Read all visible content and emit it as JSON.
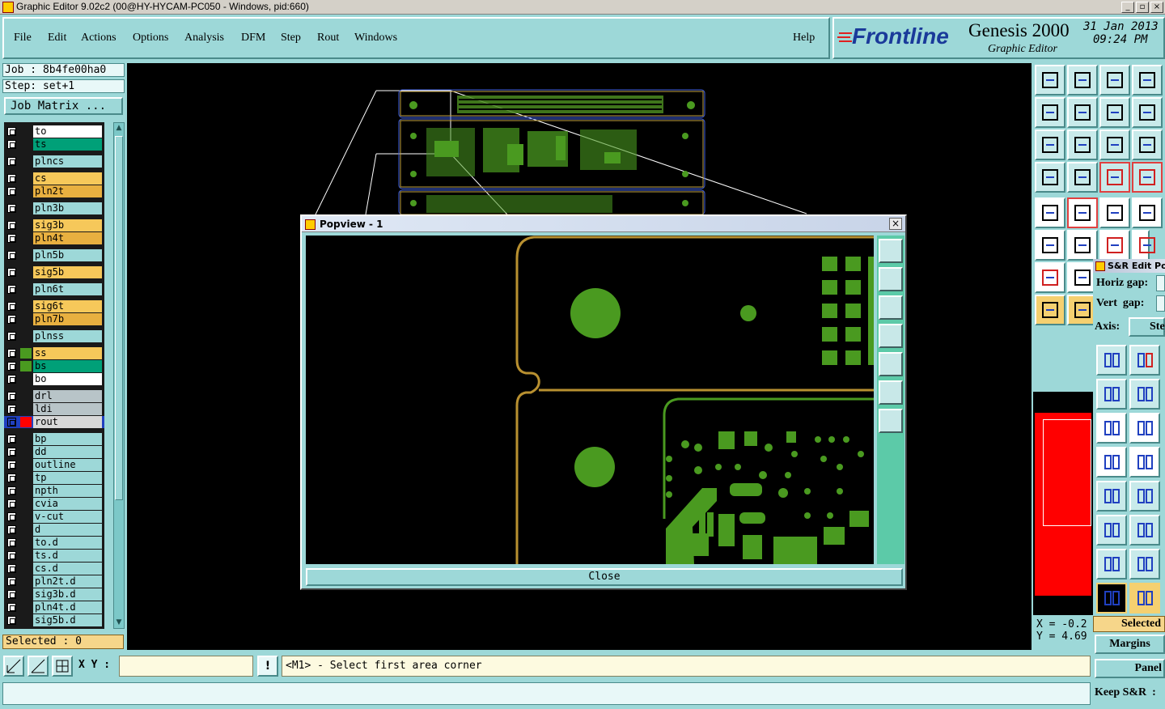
{
  "window": {
    "title": "Graphic Editor 9.02c2 (00@HY-HYCAM-PC050 - Windows, pid:660)"
  },
  "menu": [
    "File",
    "Edit",
    "Actions",
    "Options",
    "Analysis",
    "DFM",
    "Step",
    "Rout",
    "Windows"
  ],
  "help_label": "Help",
  "brand": {
    "logo": "Frontline",
    "product": "Genesis 2000",
    "subtitle": "Graphic Editor",
    "date": "31 Jan 2013",
    "time": "09:24 PM"
  },
  "job": {
    "label": "Job : 8b4fe00ha0",
    "step": "Step: set+1",
    "matrix_button": "Job Matrix ..."
  },
  "layers": [
    {
      "name": "to",
      "color": "#ffffff"
    },
    {
      "name": "ts",
      "color": "#00a078"
    },
    {
      "name": "plncs",
      "color": "#9dd8d8"
    },
    {
      "name": "cs",
      "color": "#f6c85a"
    },
    {
      "name": "pln2t",
      "color": "#e8b040"
    },
    {
      "name": "pln3b",
      "color": "#9dd8d8"
    },
    {
      "name": "sig3b",
      "color": "#f6c85a"
    },
    {
      "name": "pln4t",
      "color": "#e8b040"
    },
    {
      "name": "pln5b",
      "color": "#9dd8d8"
    },
    {
      "name": "sig5b",
      "color": "#f6c85a"
    },
    {
      "name": "pln6t",
      "color": "#9dd8d8"
    },
    {
      "name": "sig6t",
      "color": "#f6c85a"
    },
    {
      "name": "pln7b",
      "color": "#e8b040"
    },
    {
      "name": "plnss",
      "color": "#9dd8d8"
    },
    {
      "name": "ss",
      "color": "#f6c85a"
    },
    {
      "name": "bs",
      "color": "#00a078"
    },
    {
      "name": "bo",
      "color": "#ffffff"
    },
    {
      "name": "drl",
      "color": "#b8c4c8"
    },
    {
      "name": "ldi",
      "color": "#b8c4c8"
    },
    {
      "name": "rout",
      "color": "#d8d8d8"
    },
    {
      "name": "bp",
      "color": "#9dd8d8"
    },
    {
      "name": "dd",
      "color": "#9dd8d8"
    },
    {
      "name": "outline",
      "color": "#9dd8d8"
    },
    {
      "name": "tp",
      "color": "#9dd8d8"
    },
    {
      "name": "npth",
      "color": "#9dd8d8"
    },
    {
      "name": "cvia",
      "color": "#9dd8d8"
    },
    {
      "name": "v-cut",
      "color": "#9dd8d8"
    },
    {
      "name": "d",
      "color": "#9dd8d8"
    },
    {
      "name": "to.d",
      "color": "#9dd8d8"
    },
    {
      "name": "ts.d",
      "color": "#9dd8d8"
    },
    {
      "name": "cs.d",
      "color": "#9dd8d8"
    },
    {
      "name": "pln2t.d",
      "color": "#9dd8d8"
    },
    {
      "name": "sig3b.d",
      "color": "#9dd8d8"
    },
    {
      "name": "pln4t.d",
      "color": "#9dd8d8"
    },
    {
      "name": "sig5b.d",
      "color": "#9dd8d8"
    }
  ],
  "selected": "Selected : 0",
  "popview": {
    "title": "Popview - 1",
    "close_label": "Close"
  },
  "sr_panel": {
    "title": "S&R Edit Pop",
    "horiz_label": "Horiz gap:",
    "vert_label": "Vert  gap:",
    "axis_label": "Axis:",
    "axis_value": "Step",
    "selected_label": "Selected",
    "margins_label": "Margins",
    "panel_label": "Panel",
    "keep_label": "Keep S&R  :"
  },
  "coords": {
    "x": "X = -0.2",
    "y": "Y = 4.69"
  },
  "xy_label": "X Y :",
  "xy_value": "",
  "message": "<M1> - Select first area corner"
}
